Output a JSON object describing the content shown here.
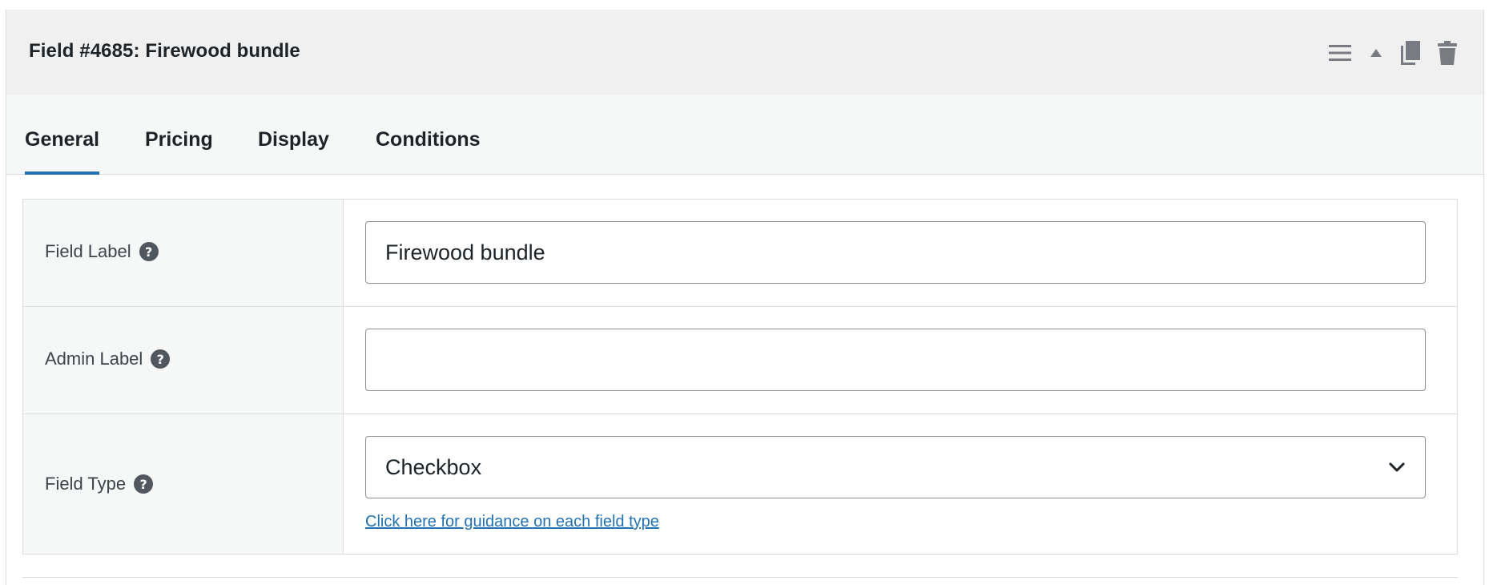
{
  "panel": {
    "title": "Field #4685: Firewood bundle",
    "actions": {
      "menu_icon": "hamburger-icon",
      "collapse_icon": "triangle-up-icon",
      "copy_icon": "duplicate-icon",
      "delete_icon": "trash-icon"
    }
  },
  "tabs": [
    {
      "label": "General",
      "active": true
    },
    {
      "label": "Pricing",
      "active": false
    },
    {
      "label": "Display",
      "active": false
    },
    {
      "label": "Conditions",
      "active": false
    }
  ],
  "fields": {
    "field_label": {
      "label": "Field Label",
      "value": "Firewood bundle",
      "placeholder": ""
    },
    "admin_label": {
      "label": "Admin Label",
      "value": "",
      "placeholder": ""
    },
    "field_type": {
      "label": "Field Type",
      "selected": "Checkbox",
      "guidance_link": "Click here for guidance on each field type"
    }
  },
  "help_glyph": "?",
  "colors": {
    "accent": "#2271b1",
    "header_bg": "#f0f0f1",
    "border": "#dcdcde",
    "icon": "#787c82"
  }
}
